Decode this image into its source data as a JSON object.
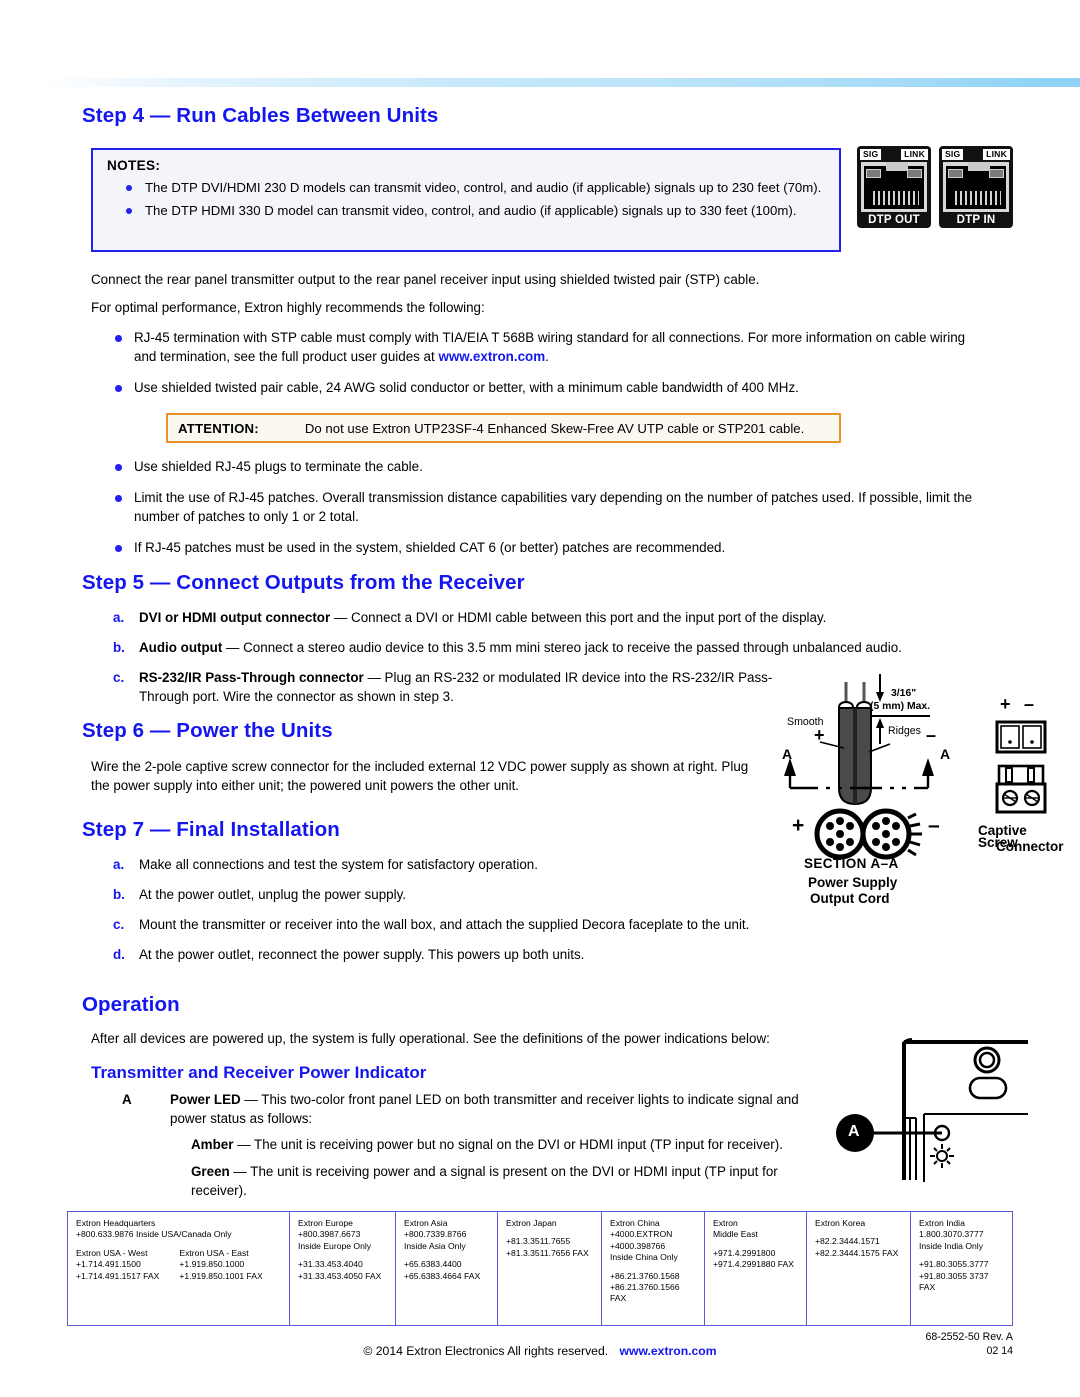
{
  "top_rule": {
    "color_light": "#ffffff",
    "color_dark": "#8fd2f5"
  },
  "accent_blue": "#1416f0",
  "step4": {
    "heading": "Step 4 — Run Cables Between Units",
    "notes_title": "NOTES:",
    "notes": [
      "The DTP DVI/HDMI 230 D models can transmit video, control, and audio (if applicable) signals up to 230 feet (70m).",
      "The DTP HDMI 330 D model can transmit video, control, and audio (if applicable) signals up to 330 feet (100m)."
    ],
    "jacks": [
      {
        "sig": "SIG",
        "link": "LINK",
        "label": "DTP OUT"
      },
      {
        "sig": "SIG",
        "link": "LINK",
        "label": "DTP IN"
      }
    ],
    "intro1": "Connect the rear panel transmitter output to the rear panel receiver input using shielded twisted pair (STP) cable.",
    "intro2": "For optimal performance, Extron highly recommends the following:",
    "bullets_a": [
      {
        "text_before": "RJ-45 termination with STP cable must comply with TIA/EIA T 568B wiring standard for all connections. For more information on cable wiring and termination, see the full product user guides at ",
        "link": "www.extron.com",
        "text_after": "."
      },
      {
        "text_before": "Use shielded twisted pair cable, 24 AWG solid conductor or better, with a minimum cable bandwidth of 400 MHz.",
        "link": "",
        "text_after": ""
      }
    ],
    "attention": {
      "title": "ATTENTION:",
      "message": "Do not use Extron UTP23SF-4 Enhanced Skew-Free AV UTP cable or STP201 cable.",
      "border_color": "#e8922a"
    },
    "bullets_b": [
      "Use shielded RJ-45 plugs to terminate the cable.",
      "Limit the use of RJ-45 patches. Overall transmission distance capabilities vary depending on the number of patches used. If possible, limit the number of patches to only 1 or 2 total.",
      "If RJ-45 patches must be used in the system, shielded CAT 6 (or better) patches are recommended."
    ]
  },
  "step5": {
    "heading": "Step 5 — Connect Outputs from the Receiver",
    "items": [
      {
        "letter": "a.",
        "bold": "DVI or HDMI output connector",
        "rest": " — Connect a DVI or HDMI cable between this port and the input port of the display."
      },
      {
        "letter": "b.",
        "bold": "Audio output",
        "rest": " — Connect a stereo audio device to this 3.5 mm mini stereo jack to receive the passed through unbalanced audio."
      },
      {
        "letter": "c.",
        "bold": "RS-232/IR Pass-Through connector",
        "rest": " — Plug an RS-232 or modulated IR device into the RS-232/IR Pass-Through port. Wire the connector as shown in step 3."
      }
    ]
  },
  "step6": {
    "heading": "Step 6 — Power the Units",
    "paragraph": "Wire the 2-pole captive screw connector for the included external 12 VDC power supply as shown at right. Plug the power supply into either unit; the powered unit powers the other unit."
  },
  "step7": {
    "heading": "Step 7 — Final Installation",
    "items": [
      {
        "letter": "a.",
        "text": "Make all connections and test the system for satisfactory operation."
      },
      {
        "letter": "b.",
        "text": "At the power outlet, unplug the power supply."
      },
      {
        "letter": "c.",
        "text": "Mount the transmitter or receiver into the wall box, and attach the supplied Decora faceplate to the unit."
      },
      {
        "letter": "d.",
        "text": "At the power outlet, reconnect the power supply. This powers up both units."
      }
    ]
  },
  "ps_diagram": {
    "dim_label1": "3/16\"",
    "dim_label2": "(5 mm) Max.",
    "smooth": "Smooth",
    "ridges": "Ridges",
    "plus": "+",
    "minus": "–",
    "a_left": "A",
    "a_right": "A",
    "section": "SECTION  A–A",
    "caption1": "Power Supply",
    "caption2": "Output Cord",
    "captive1": "Captive Screw",
    "captive2": "Connector",
    "captive_plus": "+",
    "captive_minus": "–"
  },
  "operation": {
    "heading": "Operation",
    "paragraph": "After all devices are powered up, the system is fully operational. See the definitions of the power indications below:",
    "subheading": "Transmitter and Receiver Power Indicator",
    "callout_letter": "A",
    "item_a": {
      "letter": "A",
      "bold": "Power LED",
      "rest": " — This two-color front panel LED on both transmitter and receiver lights to indicate signal and power status as follows:"
    },
    "definitions": [
      {
        "term": "Amber",
        "text": " — The unit is receiving power but no signal on the DVI or HDMI input (TP input for receiver)."
      },
      {
        "term": "Green",
        "text": " — The unit is receiving power and a signal is present on the DVI or HDMI input (TP input for receiver)."
      }
    ]
  },
  "footer": {
    "cells": [
      {
        "name": "Extron Headquarters",
        "line1": "+800.633.9876 Inside USA/Canada Only",
        "sub_left_title": "Extron USA - West",
        "sub_left_lines": [
          "+1.714.491.1500",
          "+1.714.491.1517 FAX"
        ],
        "sub_right_title": "Extron USA - East",
        "sub_right_lines": [
          "+1.919.850.1000",
          "+1.919.850.1001 FAX"
        ]
      },
      {
        "name": "Extron Europe",
        "lines_top": [
          "+800.3987.6673",
          "Inside Europe Only"
        ],
        "lines_bottom": [
          "+31.33.453.4040",
          "+31.33.453.4050 FAX"
        ]
      },
      {
        "name": "Extron Asia",
        "lines_top": [
          "+800.7339.8766",
          "Inside Asia Only"
        ],
        "lines_bottom": [
          "+65.6383.4400",
          "+65.6383.4664 FAX"
        ]
      },
      {
        "name": "Extron Japan",
        "lines_top": [],
        "lines_bottom": [
          "+81.3.3511.7655",
          "+81.3.3511.7656 FAX"
        ]
      },
      {
        "name": "Extron China",
        "lines_top": [
          "+4000.EXTRON",
          "+4000.398766",
          "Inside China Only"
        ],
        "lines_bottom": [
          "+86.21.3760.1568",
          "+86.21.3760.1566",
          "FAX"
        ]
      },
      {
        "name": "Extron",
        "name2": "Middle East",
        "lines_top": [],
        "lines_bottom": [
          "+971.4.2991800",
          "+971.4.2991880 FAX"
        ]
      },
      {
        "name": "Extron Korea",
        "lines_top": [],
        "lines_bottom": [
          "+82.2.3444.1571",
          "+82.2.3444.1575 FAX"
        ]
      },
      {
        "name": "Extron India",
        "lines_top": [
          "1.800.3070.3777",
          "Inside India Only"
        ],
        "lines_bottom": [
          "+91.80.3055.3777",
          "+91.80.3055 3737",
          "FAX"
        ]
      }
    ],
    "copyright": "© 2014 Extron Electronics  All rights reserved.",
    "copyright_link": "www.extron.com",
    "part_number": "68-2552-50 Rev. A",
    "date_code": "02 14"
  }
}
